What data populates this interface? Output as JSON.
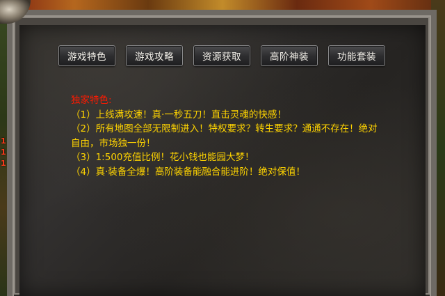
{
  "tabs": [
    {
      "label": "游戏特色"
    },
    {
      "label": "游戏攻略"
    },
    {
      "label": "资源获取"
    },
    {
      "label": "高阶神装"
    },
    {
      "label": "功能套装"
    }
  ],
  "content": {
    "heading": "独家特色:",
    "lines": [
      "（1）上线满攻速！真·一秒五刀！直击灵魂的快感！",
      "（2）所有地图全部无限制进入！特权要求？转生要求？通通不存在！绝对",
      "自由，市场独一份！",
      "（3）1:500充值比例！花小钱也能园大梦！",
      "（4）真·装备全爆！高阶装备能融合能进阶！绝对保值！"
    ]
  },
  "side_markers": [
    "1",
    "1",
    "1"
  ],
  "colors": {
    "heading": "#ff1a00",
    "body_text": "#ffd400",
    "panel_background": "#2c2a27",
    "frame": "#6e6a64"
  }
}
